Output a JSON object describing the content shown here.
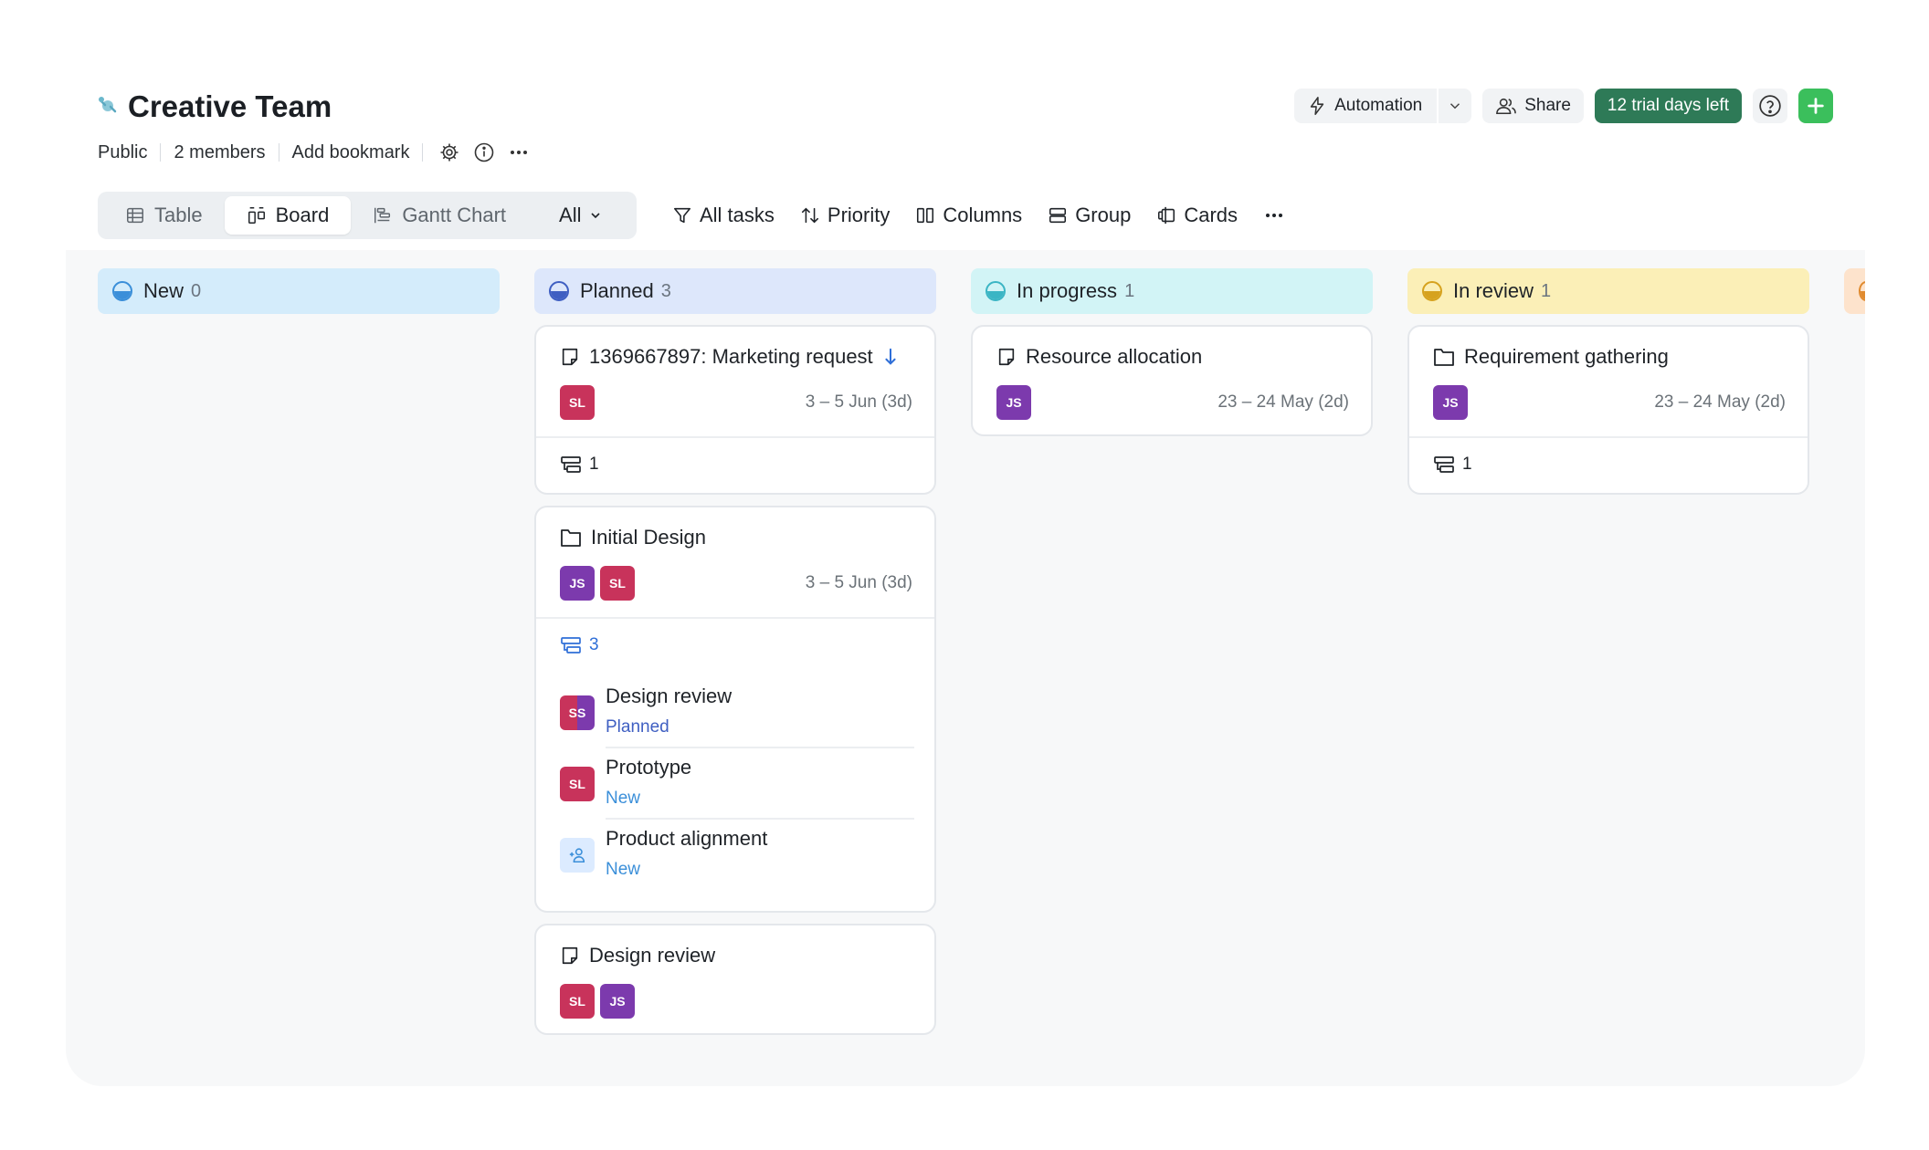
{
  "header": {
    "title": "Creative Team",
    "icon": "satellite-icon",
    "meta": [
      "Public",
      "2 members",
      "Add bookmark"
    ],
    "automation_label": "Automation",
    "share_label": "Share",
    "trial_label": "12 trial days left",
    "trial_color": "#2e7a57",
    "add_color": "#3bbf5c"
  },
  "views": {
    "table": "Table",
    "board": "Board",
    "gantt": "Gantt Chart",
    "all": "All",
    "active": "Board"
  },
  "toolbar": {
    "all_tasks": "All tasks",
    "priority": "Priority",
    "columns": "Columns",
    "group": "Group",
    "cards": "Cards"
  },
  "columns": [
    {
      "name": "New",
      "count": "0",
      "bg": "#d4ecfb",
      "icon_color": "#3b8fd9"
    },
    {
      "name": "Planned",
      "count": "3",
      "bg": "#dde7fb",
      "icon_color": "#3f5fc2"
    },
    {
      "name": "In progress",
      "count": "1",
      "bg": "#d2f4f6",
      "icon_color": "#3bb5c4"
    },
    {
      "name": "In review",
      "count": "1",
      "bg": "#fbefb7",
      "icon_color": "#d6a21e"
    }
  ],
  "cards": {
    "marketing": {
      "title": "1369667897: Marketing request",
      "date": "3 – 5 Jun (3d)",
      "subtasks": "1",
      "assignees": [
        "SL"
      ]
    },
    "initial_design": {
      "title": "Initial Design",
      "date": "3 – 5 Jun (3d)",
      "subtasks": "3",
      "assignees": [
        "JS",
        "SL"
      ],
      "subtask_items": [
        {
          "title": "Design review",
          "status": "Planned",
          "status_color": "#3f5fc2",
          "initials": "SS"
        },
        {
          "title": "Prototype",
          "status": "New",
          "status_color": "#3b8fd9",
          "initials": "SL"
        },
        {
          "title": "Product alignment",
          "status": "New",
          "status_color": "#3b8fd9",
          "initials": ""
        }
      ]
    },
    "design_review": {
      "title": "Design review",
      "assignees": [
        "SL",
        "JS"
      ]
    },
    "resource_allocation": {
      "title": "Resource allocation",
      "date": "23 – 24 May (2d)",
      "assignees": [
        "JS"
      ]
    },
    "requirement_gathering": {
      "title": "Requirement gathering",
      "date": "23 – 24 May (2d)",
      "subtasks": "1",
      "assignees": [
        "JS"
      ]
    }
  }
}
